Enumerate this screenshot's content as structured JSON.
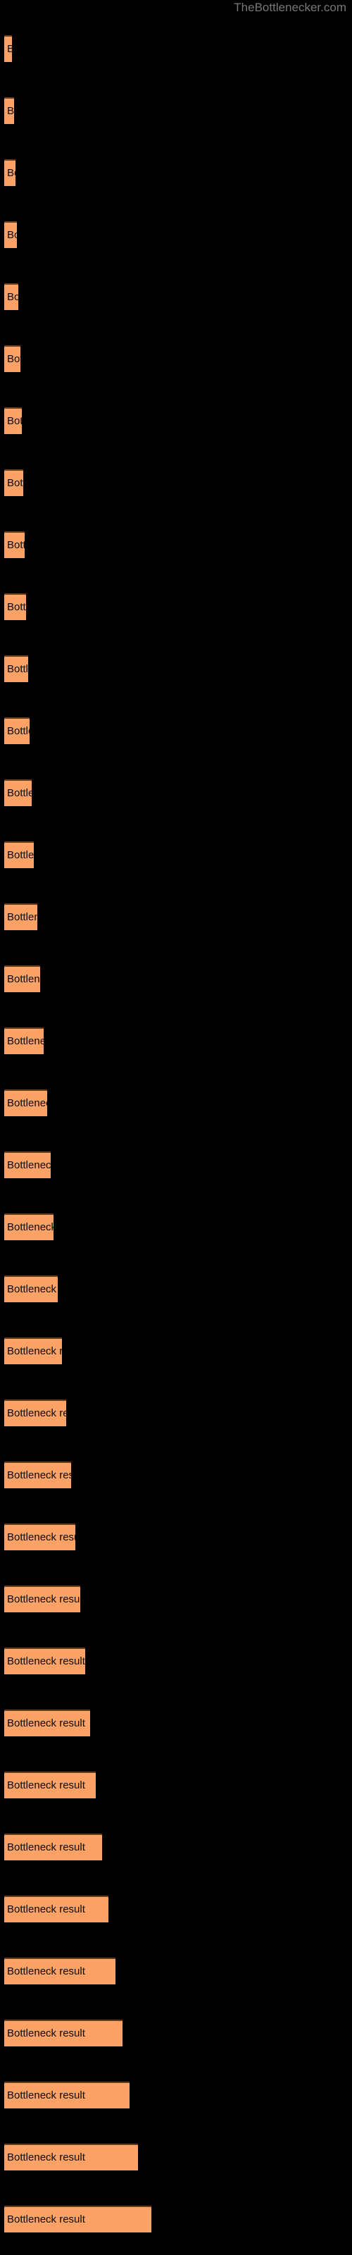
{
  "watermark": {
    "text": "TheBottlenecker.com"
  },
  "colors": {
    "background": "#000000",
    "bar_fill": "#FCA266",
    "bar_top_border": "#6B3A18",
    "label_text": "#0a0a0a",
    "watermark_text": "#787878"
  },
  "chart_data": {
    "type": "bar",
    "orientation": "horizontal",
    "title": "",
    "subtitle": "",
    "xlabel": "",
    "ylabel": "",
    "grid": false,
    "legend": null,
    "xlim": [
      0,
      500
    ],
    "bar_label_text": "Bottleneck result",
    "categories": [
      "Bottleneck result",
      "Bottleneck result",
      "Bottleneck result",
      "Bottleneck result",
      "Bottleneck result",
      "Bottleneck result",
      "Bottleneck result",
      "Bottleneck result",
      "Bottleneck result",
      "Bottleneck result",
      "Bottleneck result",
      "Bottleneck result",
      "Bottleneck result",
      "Bottleneck result",
      "Bottleneck result",
      "Bottleneck result",
      "Bottleneck result",
      "Bottleneck result",
      "Bottleneck result",
      "Bottleneck result",
      "Bottleneck result",
      "Bottleneck result",
      "Bottleneck result",
      "Bottleneck result",
      "Bottleneck result",
      "Bottleneck result",
      "Bottleneck result",
      "Bottleneck result",
      "Bottleneck result",
      "Bottleneck result",
      "Bottleneck result",
      "Bottleneck result",
      "Bottleneck result",
      "Bottleneck result",
      "Bottleneck result",
      "Bottleneck result"
    ],
    "values": [
      11,
      14,
      16,
      18,
      20,
      23,
      25,
      27,
      29,
      31,
      34,
      36,
      39,
      42,
      47,
      51,
      56,
      61,
      66,
      70,
      76,
      82,
      88,
      95,
      101,
      108,
      115,
      122,
      130,
      139,
      148,
      158,
      168,
      178,
      190,
      209
    ],
    "bar_tops": [
      50,
      138,
      226,
      314,
      402,
      490,
      578,
      666,
      754,
      842,
      930,
      1018,
      1106,
      1194,
      1282,
      1370,
      1458,
      1546,
      1634,
      1722,
      1810,
      1898,
      1986,
      2074,
      2162,
      2250,
      2338,
      2426,
      2514,
      2602,
      2690,
      2778,
      2866,
      2954,
      3042,
      3130
    ]
  }
}
